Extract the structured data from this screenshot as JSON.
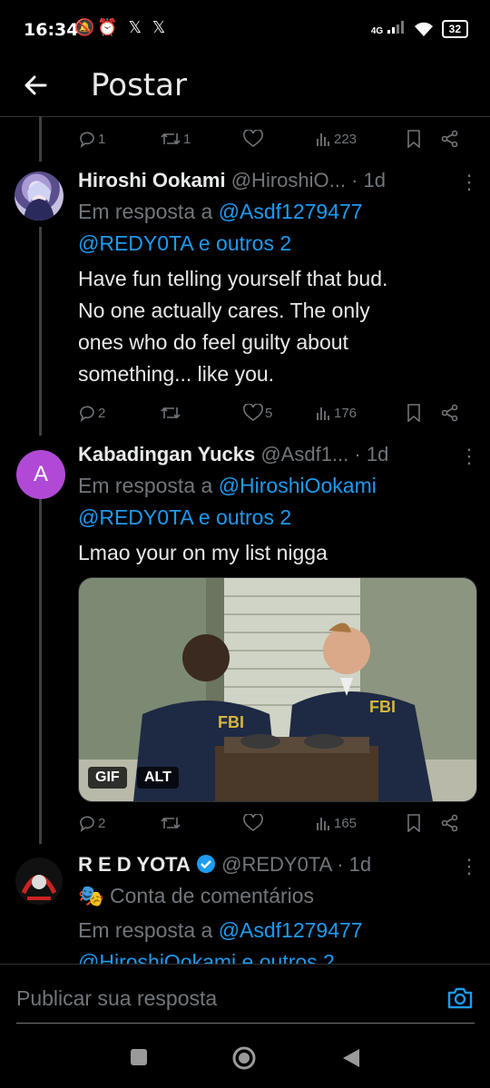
{
  "status_bar": {
    "time": "16:34",
    "left_icons": [
      "mute-notification",
      "alarm",
      "x-notification",
      "x-notification"
    ],
    "left_icons_text": "⏰ 𝕏 𝕏",
    "network": "4G",
    "battery": "32"
  },
  "header": {
    "title": "Postar"
  },
  "top_actions": {
    "replies": "1",
    "reposts": "1",
    "likes": "",
    "views": "223"
  },
  "tweets": [
    {
      "display_name": "Hiroshi Ookami",
      "handle": "@HiroshiO...",
      "time": "· 1d",
      "reply_prefix": "Em resposta a ",
      "reply_mention1": "@Asdf1279477",
      "reply_line2": "@REDY0TA e outros 2",
      "text": [
        "Have fun telling yourself that bud.",
        "No one actually cares. The only",
        "ones who do feel guilty about",
        "something... like you."
      ],
      "actions": {
        "replies": "2",
        "reposts": "",
        "likes": "5",
        "views": "176"
      }
    },
    {
      "avatar_letter": "A",
      "display_name": "Kabadingan Yucks",
      "handle": "@Asdf1...",
      "time": "· 1d",
      "reply_prefix": "Em resposta a ",
      "reply_mention1": "@HiroshiOokami",
      "reply_line2": "@REDY0TA e outros 2",
      "text": [
        "Lmao your on my list nigga"
      ],
      "media_badges": [
        "GIF",
        "ALT"
      ],
      "actions": {
        "replies": "2",
        "reposts": "",
        "likes": "",
        "views": "165"
      }
    },
    {
      "display_name": "R E D YOTA",
      "handle": "@REDY0TA",
      "time": "· 1d",
      "account_label": "Conta de comentários",
      "reply_prefix": "Em resposta a ",
      "reply_mention1": "@Asdf1279477",
      "reply_line2": "@HiroshiOokami e outros 2"
    }
  ],
  "reply_bar": {
    "placeholder": "Publicar sua resposta"
  },
  "colors": {
    "accent": "#1d9bf0",
    "muted": "#71767b",
    "text": "#e7e9ea",
    "bg": "#000000",
    "avatar_purple": "#b04ad6"
  }
}
